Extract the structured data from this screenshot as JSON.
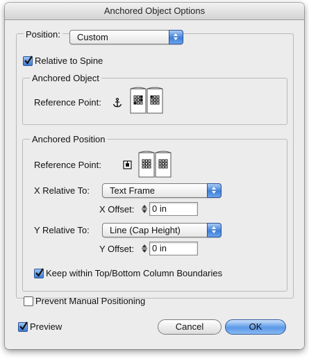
{
  "window": {
    "title": "Anchored Object Options"
  },
  "position": {
    "label": "Position:",
    "value": "Custom"
  },
  "relative_to_spine": {
    "label": "Relative to Spine",
    "checked": true
  },
  "anchored_object": {
    "group_title": "Anchored Object",
    "reference_point_label": "Reference Point:"
  },
  "anchored_position": {
    "group_title": "Anchored Position",
    "reference_point_label": "Reference Point:",
    "x_relative_label": "X Relative To:",
    "x_relative_value": "Text Frame",
    "x_offset_label": "X Offset:",
    "x_offset_value": "0 in",
    "y_relative_label": "Y Relative To:",
    "y_relative_value": "Line (Cap Height)",
    "y_offset_label": "Y Offset:",
    "y_offset_value": "0 in",
    "keep_within_label": "Keep within Top/Bottom Column Boundaries",
    "keep_within_checked": true
  },
  "prevent_manual": {
    "label": "Prevent Manual Positioning",
    "checked": false
  },
  "preview": {
    "label": "Preview",
    "checked": true
  },
  "buttons": {
    "cancel": "Cancel",
    "ok": "OK"
  },
  "icons": {
    "anchor": "anchor-icon",
    "reference_grid": "reference-point-grid-icon",
    "popup_arrows": "popup-arrows-icon",
    "stepper": "stepper-arrows-icon",
    "checkmark": "checkmark-icon"
  },
  "colors": {
    "accent": "#3d7bd6",
    "window_bg": "#ececec"
  }
}
